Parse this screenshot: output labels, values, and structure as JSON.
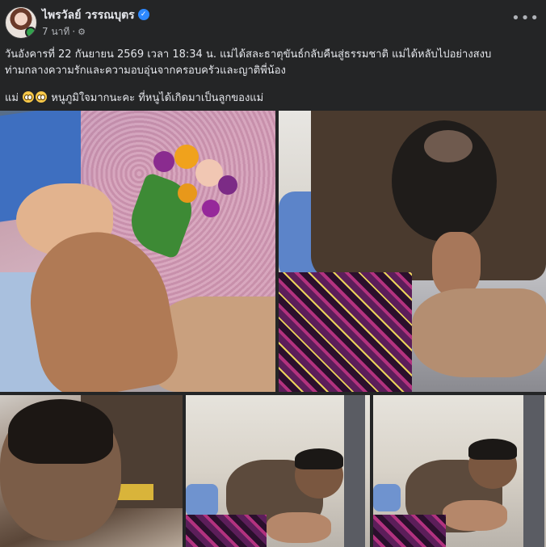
{
  "post": {
    "author": "ไพรวัลย์ วรรณบุตร",
    "verified_symbol": "✓",
    "time": "7 นาที",
    "separator": "·",
    "privacy_icon": "gear-icon",
    "more_label": "•••",
    "text_line1": "วันอังคารที่ 22 กันยายน 2569 เวลา 18:34 น. แม่ได้สละธาตุขันธ์กลับคืนสู่ธรรมชาติ แม่ได้หลับไปอย่างสงบ",
    "text_line2": "ท่ามกลางความรักและความอบอุ่นจากครอบครัวและญาติพี่น้อง",
    "text_line3_prefix": "แม่",
    "text_line3_suffix": "หนูภูมิใจมากนะคะ ที่หนูได้เกิดมาเป็นลูกของแม่",
    "emoji_name": "pleading-face-emoji"
  },
  "colors": {
    "background": "#242526",
    "text_primary": "#e4e6eb",
    "text_secondary": "#b0b3b8",
    "verified_blue": "#2d88ff",
    "online_green": "#31a24c"
  }
}
